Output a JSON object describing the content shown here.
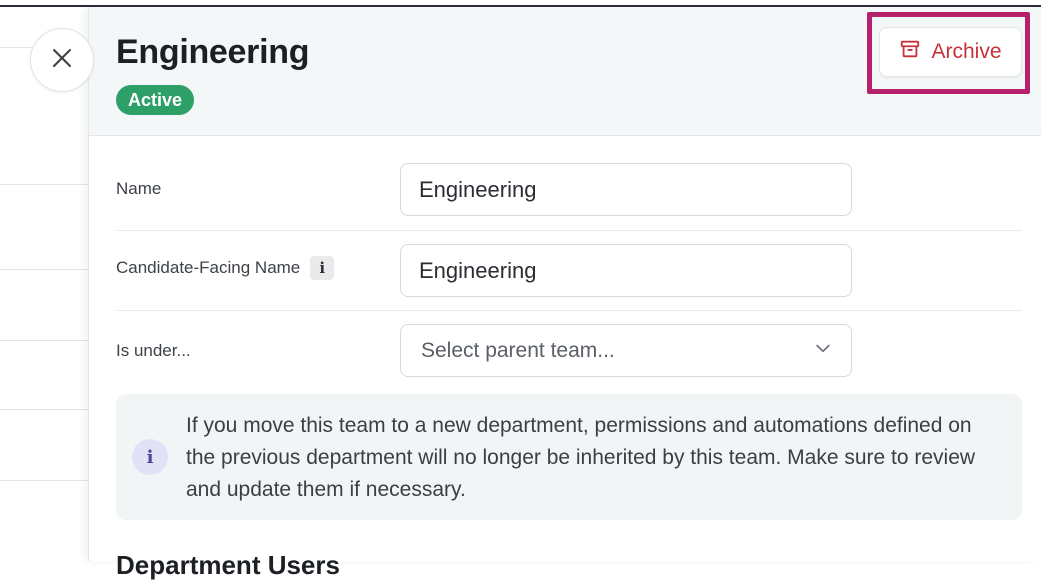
{
  "header": {
    "title": "Engineering",
    "status": "Active",
    "archive_label": "Archive"
  },
  "form": {
    "name": {
      "label": "Name",
      "value": "Engineering"
    },
    "candidate_facing_name": {
      "label": "Candidate-Facing Name",
      "info_glyph": "i",
      "value": "Engineering"
    },
    "parent_team": {
      "label": "Is under...",
      "placeholder": "Select parent team..."
    }
  },
  "notice": {
    "icon_glyph": "i",
    "text": "If you move this team to a new department, permissions and automations defined on the previous department will no longer be inherited by this team. Make sure to review and update them if necessary."
  },
  "section": {
    "heading": "Department Users"
  },
  "icons": {
    "close": "close-icon",
    "archive": "archive-box-icon",
    "chevron": "chevron-down-icon",
    "info": "info-icon"
  },
  "colors": {
    "active_badge": "#2f9f68",
    "archive_text": "#c8323a",
    "highlight_frame": "#b5216b",
    "header_bg": "#f4f7f8",
    "info_box_bg": "#f2f5f6"
  }
}
